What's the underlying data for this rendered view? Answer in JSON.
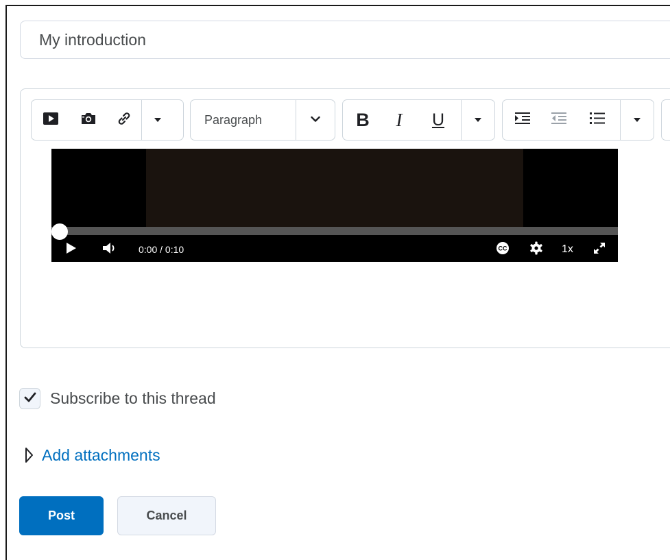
{
  "subject": {
    "value": "My introduction"
  },
  "toolbar": {
    "insert_group": {
      "video_icon": "video-icon",
      "camera_icon": "camera-icon",
      "link_icon": "link-icon",
      "more_icon": "caret-down-icon"
    },
    "block_format": {
      "selected": "Paragraph"
    },
    "format_group": {
      "bold_label": "B",
      "italic_label": "I",
      "underline_label": "U"
    },
    "list_group": {
      "indent_icon": "indent-icon",
      "outdent_icon": "outdent-icon",
      "bullet_list_icon": "bullet-list-icon"
    }
  },
  "video_player": {
    "current_time": "0:00",
    "duration": " / 0:10",
    "progress": 0,
    "speed": "1x"
  },
  "subscribe": {
    "label": "Subscribe to this thread",
    "checked": true
  },
  "attachments": {
    "label": "Add attachments"
  },
  "actions": {
    "post_label": "Post",
    "cancel_label": "Cancel"
  },
  "colors": {
    "primary": "#006fbf",
    "link": "#006fbf",
    "border": "#cdd5dc",
    "text": "#494c4e"
  }
}
